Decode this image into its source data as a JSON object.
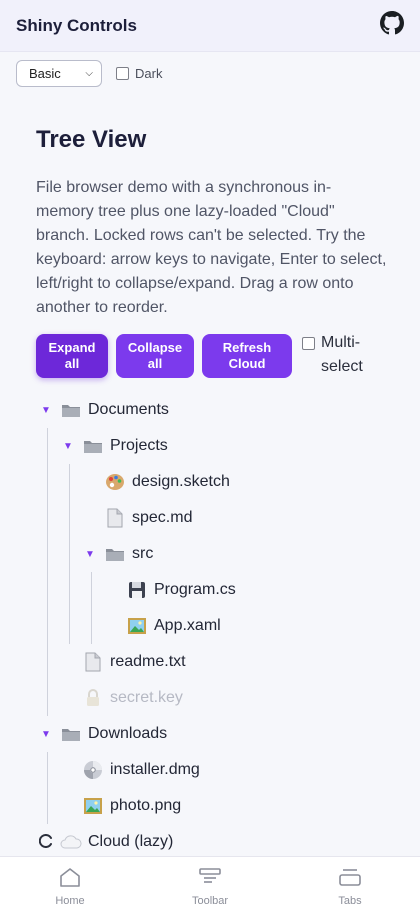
{
  "header": {
    "title": "Shiny Controls",
    "github_icon": "github-icon"
  },
  "controls": {
    "theme_select": {
      "value": "Basic",
      "options": [
        "Basic"
      ]
    },
    "dark_checkbox": {
      "label": "Dark",
      "checked": false
    }
  },
  "page": {
    "title": "Tree View",
    "description": "File browser demo with a synchronous in-memory tree plus one lazy-loaded \"Cloud\" branch. Locked rows can't be selected. Try the keyboard: arrow keys to navigate, Enter to select, left/right to collapse/expand. Drag a row onto another to reorder."
  },
  "actions": {
    "expand_all": "Expand all",
    "collapse_all": "Collapse all",
    "refresh_cloud": "Refresh Cloud",
    "multi_select": {
      "label": "Multi-select",
      "checked": false
    }
  },
  "tree": [
    {
      "label": "Documents",
      "icon": "folder-icon",
      "expanded": true,
      "depth": 0
    },
    {
      "label": "Projects",
      "icon": "folder-icon",
      "expanded": true,
      "depth": 1
    },
    {
      "label": "design.sketch",
      "icon": "palette-icon",
      "depth": 2
    },
    {
      "label": "spec.md",
      "icon": "document-icon",
      "depth": 2
    },
    {
      "label": "src",
      "icon": "folder-icon",
      "expanded": true,
      "depth": 2
    },
    {
      "label": "Program.cs",
      "icon": "floppy-disk-icon",
      "depth": 3
    },
    {
      "label": "App.xaml",
      "icon": "picture-icon",
      "depth": 3
    },
    {
      "label": "readme.txt",
      "icon": "document-icon",
      "depth": 1
    },
    {
      "label": "secret.key",
      "icon": "lock-icon",
      "depth": 1,
      "locked": true
    },
    {
      "label": "Downloads",
      "icon": "folder-icon",
      "expanded": true,
      "depth": 0
    },
    {
      "label": "installer.dmg",
      "icon": "disc-icon",
      "depth": 1
    },
    {
      "label": "photo.png",
      "icon": "picture-icon",
      "depth": 1
    },
    {
      "label": "Cloud (lazy)",
      "icon": "cloud-icon",
      "depth": 0,
      "loading": true
    }
  ],
  "tabbar": {
    "items": [
      {
        "label": "Home",
        "icon": "home-icon"
      },
      {
        "label": "Toolbar",
        "icon": "toolbar-icon"
      },
      {
        "label": "Tabs",
        "icon": "tabs-icon"
      }
    ]
  },
  "colors": {
    "accent": "#7c3aed",
    "accent_dark": "#6d28d9",
    "header_bg": "#f1f1fb"
  }
}
